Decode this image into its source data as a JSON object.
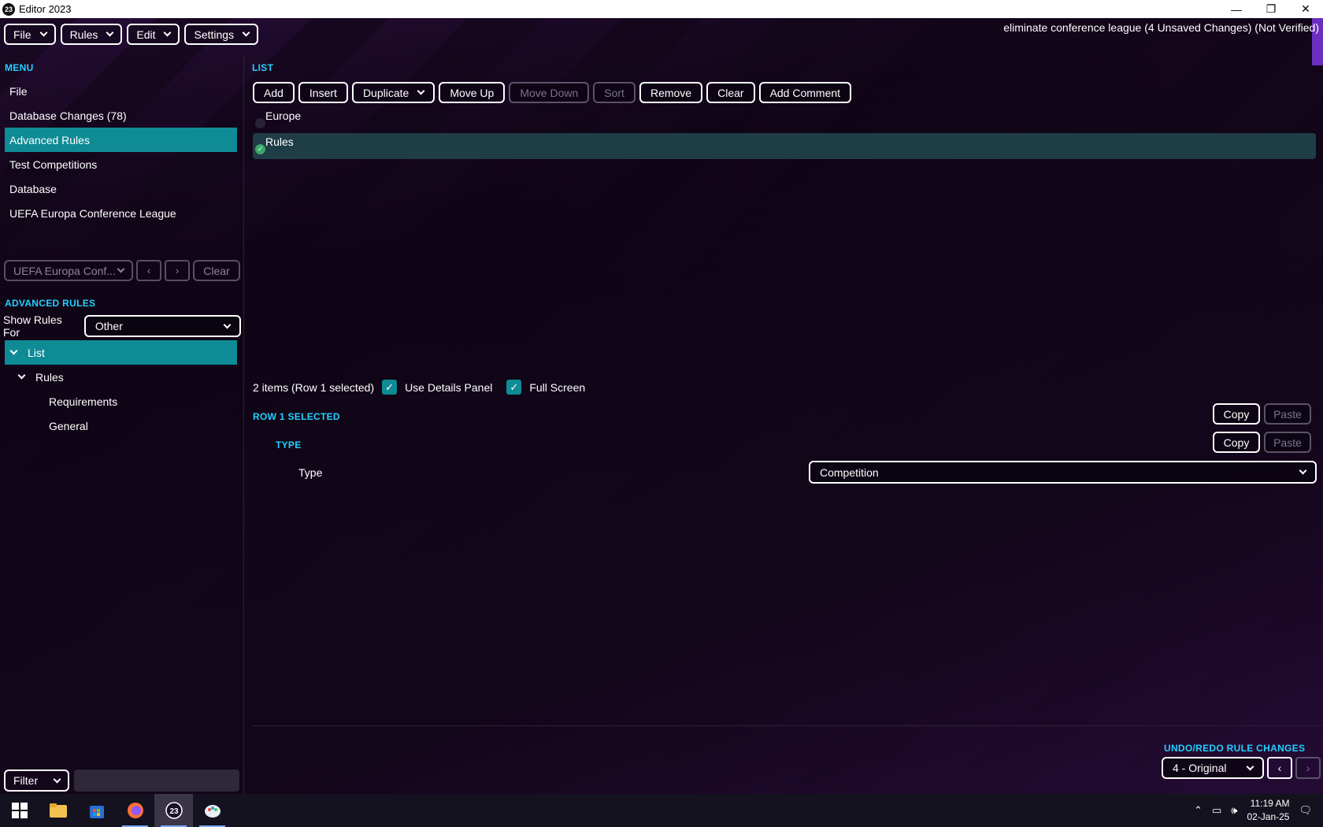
{
  "window": {
    "title": "Editor 2023",
    "app_icon_text": "23",
    "minimize": "—",
    "restore": "❐",
    "close": "✕"
  },
  "menubar": {
    "file": "File",
    "rules": "Rules",
    "edit": "Edit",
    "settings": "Settings"
  },
  "status": "eliminate conference league (4 Unsaved Changes) (Not Verified)",
  "left": {
    "menu_title": "MENU",
    "menu_items": [
      {
        "label": "File"
      },
      {
        "label": "Database Changes (78)"
      },
      {
        "label": "Advanced Rules",
        "selected": true
      },
      {
        "label": "Test Competitions"
      },
      {
        "label": "Database"
      },
      {
        "label": "UEFA Europa Conference League"
      }
    ],
    "nav_dropdown": "UEFA Europa Conf...",
    "nav_prev": "‹",
    "nav_next": "›",
    "nav_clear": "Clear",
    "adv_title": "ADVANCED RULES",
    "show_rules_label": "Show Rules For",
    "show_rules_value": "Other",
    "tree": [
      {
        "label": "List",
        "selected": true
      },
      {
        "label": "Rules"
      },
      {
        "label": "Requirements"
      },
      {
        "label": "General"
      }
    ],
    "filter_label": "Filter"
  },
  "main": {
    "list_title": "LIST",
    "toolbar": {
      "add": "Add",
      "insert": "Insert",
      "duplicate": "Duplicate",
      "move_up": "Move Up",
      "move_down": "Move Down",
      "sort": "Sort",
      "remove": "Remove",
      "clear": "Clear",
      "add_comment": "Add Comment"
    },
    "rows": [
      {
        "label": "Europe",
        "selected": false
      },
      {
        "label": "Rules",
        "selected": true
      }
    ],
    "items_info": "2 items (Row 1 selected)",
    "use_details_label": "Use Details Panel",
    "full_screen_label": "Full Screen",
    "row1_title": "ROW 1 SELECTED",
    "type_title": "TYPE",
    "copy": "Copy",
    "paste": "Paste",
    "type_label": "Type",
    "type_value": "Competition"
  },
  "undo": {
    "title": "UNDO/REDO RULE CHANGES",
    "value": "4 - Original",
    "prev": "‹",
    "next": "›"
  },
  "taskbar": {
    "time": "11:19 AM",
    "date": "02-Jan-25",
    "fm_icon_text": "23"
  },
  "colors": {
    "accent": "#23d0ff",
    "selection": "#0f8b96",
    "background": "#1a0b22"
  }
}
